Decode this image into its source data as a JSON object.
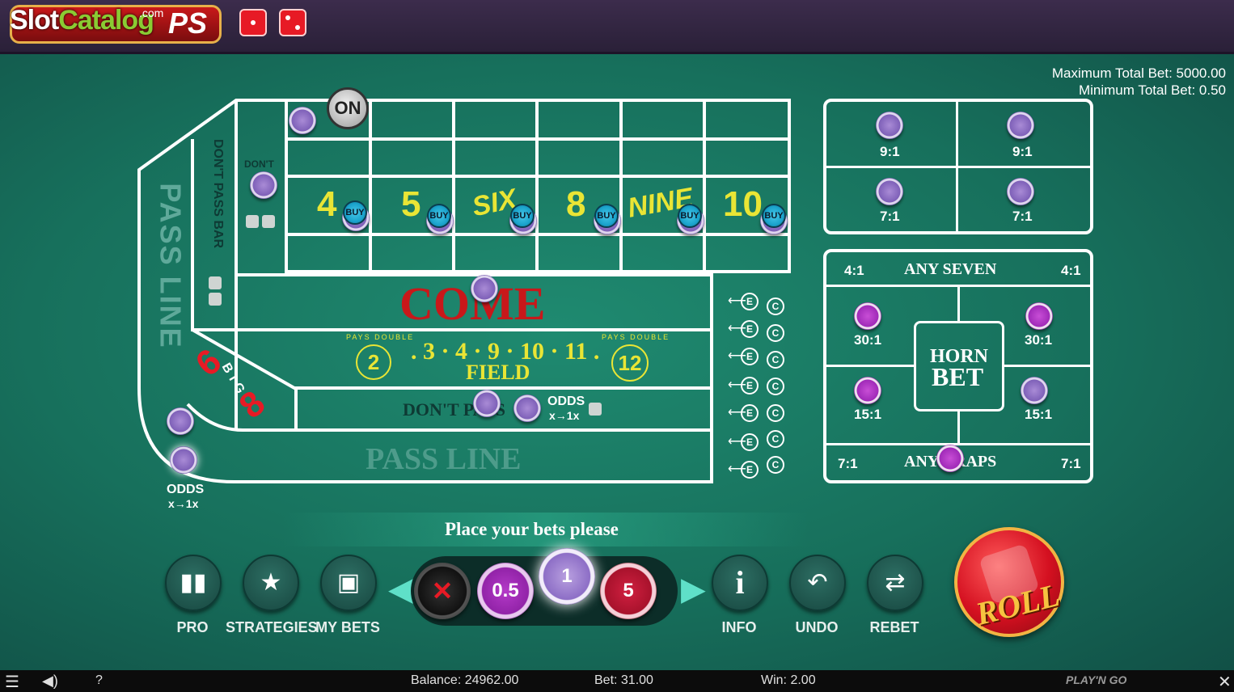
{
  "header": {
    "logo_text_slot": "Slot",
    "logo_text_catalog": "Catalog",
    "logo_com": ".com",
    "logo_suffix": "PS"
  },
  "limits": {
    "max_total_bet": "Maximum Total Bet: 5000.00",
    "min_total_bet": "Minimum Total Bet: 0.50"
  },
  "table": {
    "on_puck": "ON",
    "dont_come": "DON'T",
    "dont_pass_bar": "DON'T PASS BAR",
    "pass_line_side": "PASS LINE",
    "points": [
      "4",
      "5",
      "SIX",
      "8",
      "NINE",
      "10"
    ],
    "buy_label": "BUY",
    "come": "COME",
    "field_numbers": ". 3 · 4 · 9 · 10 · 11 .",
    "field": "FIELD",
    "field_low": "2",
    "field_high": "12",
    "pays_double": "PAYS DOUBLE",
    "dont_pass": "DON'T PASS",
    "odds": "ODDS",
    "odds_multiplier": "x→1x",
    "pass_line": "PASS LINE",
    "big6": "6",
    "big8": "8",
    "big_text": "BIG",
    "side_odds": "ODDS",
    "side_odds_multiplier": "x→1x",
    "ec_e": "E",
    "ec_c": "C"
  },
  "hardways": {
    "payouts": [
      "9:1",
      "9:1",
      "7:1",
      "7:1"
    ]
  },
  "proposition": {
    "any_seven": "ANY SEVEN",
    "any_seven_left": "4:1",
    "any_seven_right": "4:1",
    "horn_bet_line1": "HORN",
    "horn_bet_line2": "BET",
    "payouts": [
      "30:1",
      "30:1",
      "15:1",
      "15:1"
    ],
    "any_craps": "ANY CRAPS",
    "any_craps_left": "7:1",
    "any_craps_right": "7:1"
  },
  "status": {
    "message": "Place your bets please"
  },
  "controls": {
    "pro": "PRO",
    "strategies": "STRATEGIES",
    "my_bets": "MY BETS",
    "info": "INFO",
    "undo": "UNDO",
    "rebet": "REBET",
    "roll": "ROLL"
  },
  "chips": {
    "values": [
      "0.5",
      "1",
      "5"
    ],
    "selected": "1"
  },
  "footer": {
    "balance": "Balance: 24962.00",
    "bet": "Bet: 31.00",
    "win": "Win: 2.00",
    "help": "?",
    "brand": "PLAY'N GO"
  },
  "colors": {
    "felt": "#1f8a70",
    "point_numbers": "#e9e535",
    "come_text": "#c8181a",
    "accent_red": "#e71a25"
  }
}
